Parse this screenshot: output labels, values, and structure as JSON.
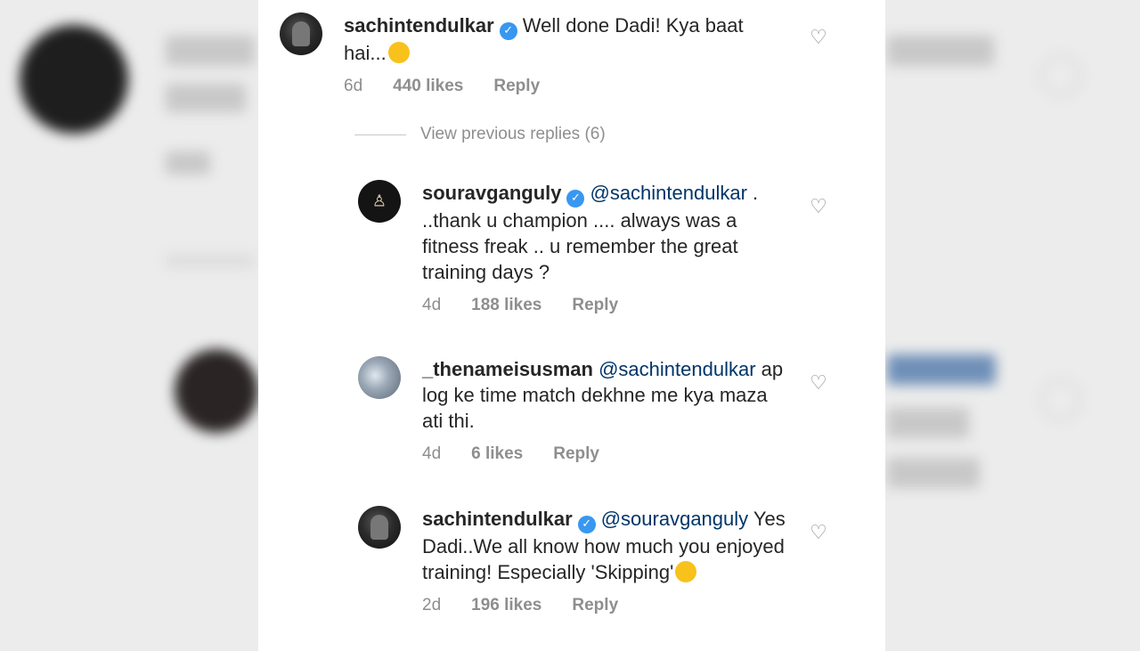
{
  "comments": [
    {
      "username": "sachintendulkar",
      "text": "Well done Dadi! Kya baat hai...",
      "emoji": "wink",
      "time": "6d",
      "likes": "440 likes",
      "reply": "Reply"
    }
  ],
  "view_previous": "View previous replies (6)",
  "replies": [
    {
      "username": "souravganguly",
      "mention": "@sachintendulkar",
      "text": " . ..thank u champion .... always was a fitness freak .. u remember the great training days ?",
      "time": "4d",
      "likes": "188 likes",
      "reply": "Reply"
    },
    {
      "username": "_thenameisusman",
      "mention": "@sachintendulkar",
      "text": " ap log ke time match dekhne me kya maza ati thi.",
      "time": "4d",
      "likes": "6 likes",
      "reply": "Reply"
    },
    {
      "username": "sachintendulkar",
      "mention": "@souravganguly",
      "text": " Yes Dadi..We all know how much you enjoyed training! Especially 'Skipping'",
      "emoji": "tongue",
      "time": "2d",
      "likes": "196 likes",
      "reply": "Reply"
    }
  ],
  "colors": {
    "verified": "#3897f0",
    "mention": "#003569",
    "meta": "#8e8e8e"
  }
}
